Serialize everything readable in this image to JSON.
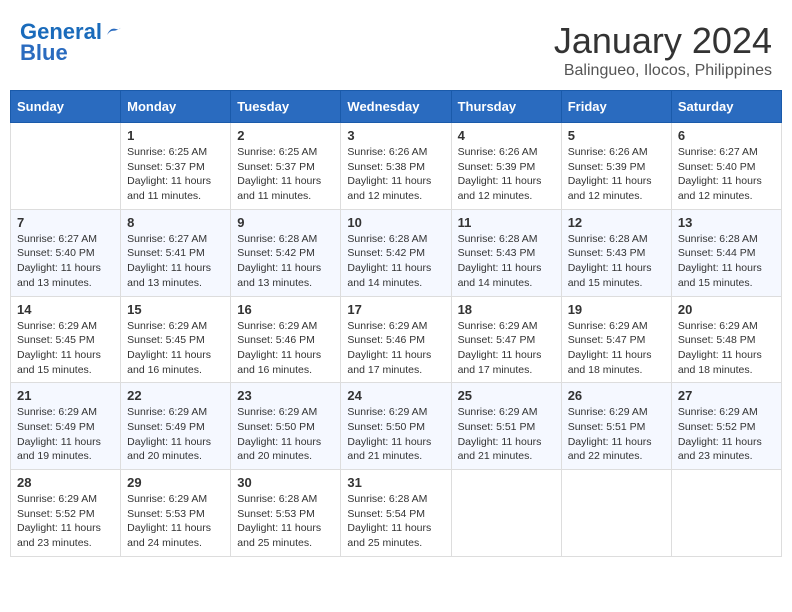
{
  "logo": {
    "line1": "General",
    "line2": "Blue"
  },
  "title": "January 2024",
  "location": "Balingueo, Ilocos, Philippines",
  "days_header": [
    "Sunday",
    "Monday",
    "Tuesday",
    "Wednesday",
    "Thursday",
    "Friday",
    "Saturday"
  ],
  "weeks": [
    [
      {
        "day": "",
        "info": ""
      },
      {
        "day": "1",
        "info": "Sunrise: 6:25 AM\nSunset: 5:37 PM\nDaylight: 11 hours and 11 minutes."
      },
      {
        "day": "2",
        "info": "Sunrise: 6:25 AM\nSunset: 5:37 PM\nDaylight: 11 hours and 11 minutes."
      },
      {
        "day": "3",
        "info": "Sunrise: 6:26 AM\nSunset: 5:38 PM\nDaylight: 11 hours and 12 minutes."
      },
      {
        "day": "4",
        "info": "Sunrise: 6:26 AM\nSunset: 5:39 PM\nDaylight: 11 hours and 12 minutes."
      },
      {
        "day": "5",
        "info": "Sunrise: 6:26 AM\nSunset: 5:39 PM\nDaylight: 11 hours and 12 minutes."
      },
      {
        "day": "6",
        "info": "Sunrise: 6:27 AM\nSunset: 5:40 PM\nDaylight: 11 hours and 12 minutes."
      }
    ],
    [
      {
        "day": "7",
        "info": "Sunrise: 6:27 AM\nSunset: 5:40 PM\nDaylight: 11 hours and 13 minutes."
      },
      {
        "day": "8",
        "info": "Sunrise: 6:27 AM\nSunset: 5:41 PM\nDaylight: 11 hours and 13 minutes."
      },
      {
        "day": "9",
        "info": "Sunrise: 6:28 AM\nSunset: 5:42 PM\nDaylight: 11 hours and 13 minutes."
      },
      {
        "day": "10",
        "info": "Sunrise: 6:28 AM\nSunset: 5:42 PM\nDaylight: 11 hours and 14 minutes."
      },
      {
        "day": "11",
        "info": "Sunrise: 6:28 AM\nSunset: 5:43 PM\nDaylight: 11 hours and 14 minutes."
      },
      {
        "day": "12",
        "info": "Sunrise: 6:28 AM\nSunset: 5:43 PM\nDaylight: 11 hours and 15 minutes."
      },
      {
        "day": "13",
        "info": "Sunrise: 6:28 AM\nSunset: 5:44 PM\nDaylight: 11 hours and 15 minutes."
      }
    ],
    [
      {
        "day": "14",
        "info": "Sunrise: 6:29 AM\nSunset: 5:45 PM\nDaylight: 11 hours and 15 minutes."
      },
      {
        "day": "15",
        "info": "Sunrise: 6:29 AM\nSunset: 5:45 PM\nDaylight: 11 hours and 16 minutes."
      },
      {
        "day": "16",
        "info": "Sunrise: 6:29 AM\nSunset: 5:46 PM\nDaylight: 11 hours and 16 minutes."
      },
      {
        "day": "17",
        "info": "Sunrise: 6:29 AM\nSunset: 5:46 PM\nDaylight: 11 hours and 17 minutes."
      },
      {
        "day": "18",
        "info": "Sunrise: 6:29 AM\nSunset: 5:47 PM\nDaylight: 11 hours and 17 minutes."
      },
      {
        "day": "19",
        "info": "Sunrise: 6:29 AM\nSunset: 5:47 PM\nDaylight: 11 hours and 18 minutes."
      },
      {
        "day": "20",
        "info": "Sunrise: 6:29 AM\nSunset: 5:48 PM\nDaylight: 11 hours and 18 minutes."
      }
    ],
    [
      {
        "day": "21",
        "info": "Sunrise: 6:29 AM\nSunset: 5:49 PM\nDaylight: 11 hours and 19 minutes."
      },
      {
        "day": "22",
        "info": "Sunrise: 6:29 AM\nSunset: 5:49 PM\nDaylight: 11 hours and 20 minutes."
      },
      {
        "day": "23",
        "info": "Sunrise: 6:29 AM\nSunset: 5:50 PM\nDaylight: 11 hours and 20 minutes."
      },
      {
        "day": "24",
        "info": "Sunrise: 6:29 AM\nSunset: 5:50 PM\nDaylight: 11 hours and 21 minutes."
      },
      {
        "day": "25",
        "info": "Sunrise: 6:29 AM\nSunset: 5:51 PM\nDaylight: 11 hours and 21 minutes."
      },
      {
        "day": "26",
        "info": "Sunrise: 6:29 AM\nSunset: 5:51 PM\nDaylight: 11 hours and 22 minutes."
      },
      {
        "day": "27",
        "info": "Sunrise: 6:29 AM\nSunset: 5:52 PM\nDaylight: 11 hours and 23 minutes."
      }
    ],
    [
      {
        "day": "28",
        "info": "Sunrise: 6:29 AM\nSunset: 5:52 PM\nDaylight: 11 hours and 23 minutes."
      },
      {
        "day": "29",
        "info": "Sunrise: 6:29 AM\nSunset: 5:53 PM\nDaylight: 11 hours and 24 minutes."
      },
      {
        "day": "30",
        "info": "Sunrise: 6:28 AM\nSunset: 5:53 PM\nDaylight: 11 hours and 25 minutes."
      },
      {
        "day": "31",
        "info": "Sunrise: 6:28 AM\nSunset: 5:54 PM\nDaylight: 11 hours and 25 minutes."
      },
      {
        "day": "",
        "info": ""
      },
      {
        "day": "",
        "info": ""
      },
      {
        "day": "",
        "info": ""
      }
    ]
  ]
}
